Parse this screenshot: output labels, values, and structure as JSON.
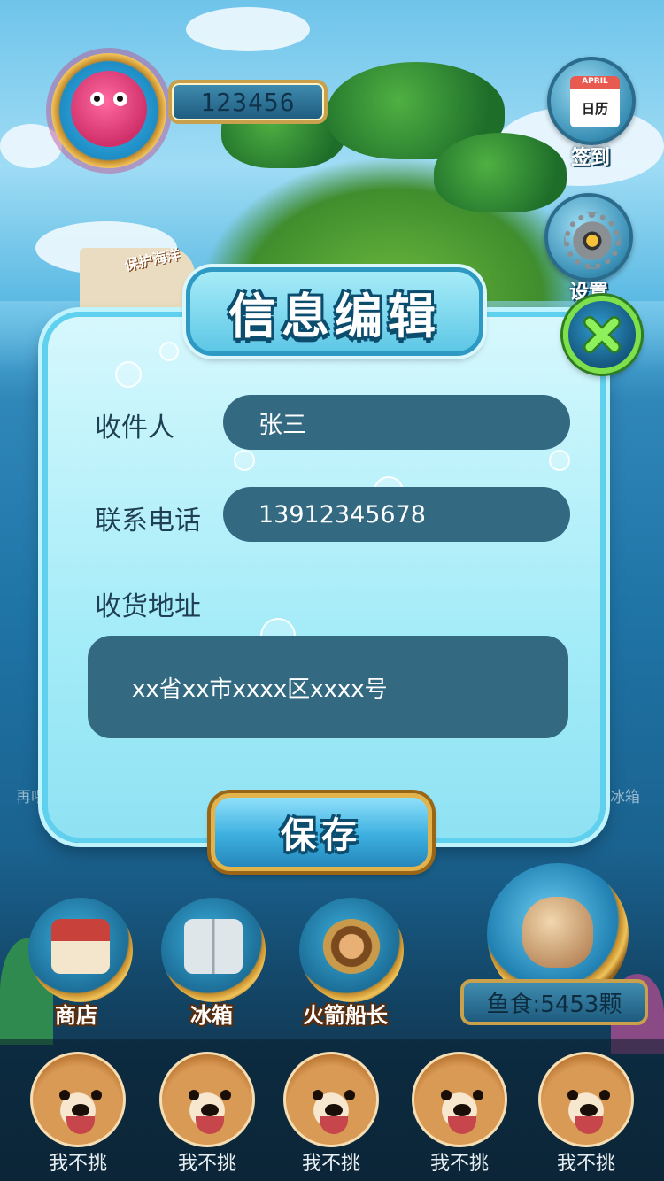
{
  "colors": {
    "dialog_bg": "#a5ecf8",
    "field_bg": "#336a82",
    "label_text": "#1f3f52",
    "close_green": "#7ee04a",
    "gold_frame": "#e2b34a"
  },
  "hud": {
    "score": "123456",
    "calendar_icon_text": "日历",
    "calendar_icon_month": "APRIL",
    "checkin_label": "签到",
    "settings_label": "设置",
    "ship_flag_text": "保护海洋"
  },
  "dialog": {
    "title": "信息编辑",
    "close_icon": "close-x-icon",
    "recipient_label": "收件人",
    "recipient_value": "张三",
    "phone_label": "联系电话",
    "phone_value": "13912345678",
    "address_label": "收货地址",
    "address_value": "xx省xx市xxxx区xxxx号",
    "save_label": "保存"
  },
  "background_hints": {
    "left_text": "再喂",
    "right_text": "入冰箱"
  },
  "menu": {
    "items": [
      {
        "label": "商店",
        "icon": "shop-icon"
      },
      {
        "label": "冰箱",
        "icon": "fridge-icon"
      },
      {
        "label": "火箭船长",
        "icon": "pirate-captain-icon"
      }
    ],
    "food_label": "鱼食:5453颗"
  },
  "dogs": [
    {
      "name": "我不挑"
    },
    {
      "name": "我不挑"
    },
    {
      "name": "我不挑"
    },
    {
      "name": "我不挑"
    },
    {
      "name": "我不挑"
    }
  ]
}
